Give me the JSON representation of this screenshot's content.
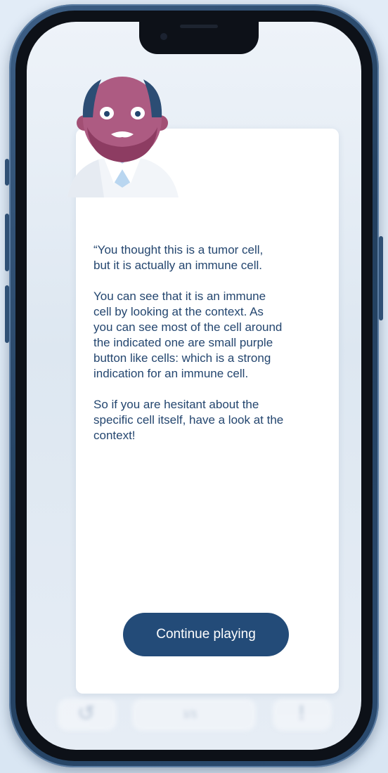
{
  "dialog": {
    "paragraphs": [
      "“You thought this is a tumor cell,\nbut it is actually an immune cell.",
      "You can see that it is an immune\ncell by looking at the context. As\nyou can see most of the cell around\nthe indicated one are small purple\nbutton like cells: which is a strong\nindication for an immune cell.",
      "So if you are hesitant about the\nspecific cell itself, have a look at the\ncontext!"
    ],
    "continue_label": "Continue playing"
  },
  "background_bar": {
    "counter": "1/1",
    "undo_icon": "undo-icon",
    "info_icon": "info-icon"
  },
  "colors": {
    "text": "#24466f",
    "button": "#234b78",
    "phone_frame": "#2b4b70"
  }
}
